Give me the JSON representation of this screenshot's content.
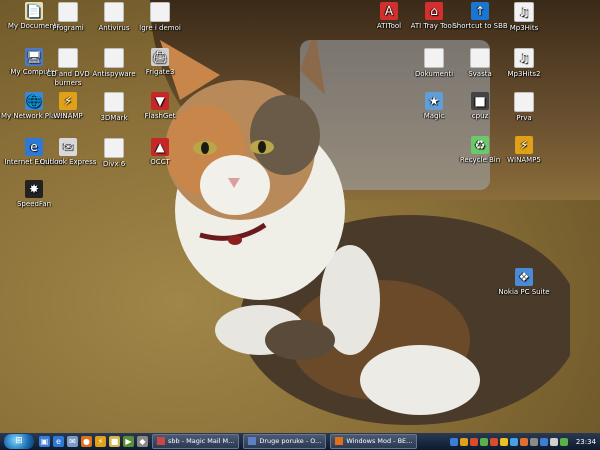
{
  "desktop": {
    "icons": [
      {
        "label": "My Documents",
        "glyph": "📄",
        "style": "g-docs"
      },
      {
        "label": "Programi",
        "glyph": "",
        "style": "g-folder"
      },
      {
        "label": "Antivirus",
        "glyph": "",
        "style": "g-folder"
      },
      {
        "label": "Igre i demoi",
        "glyph": "",
        "style": "g-folder"
      },
      {
        "label": "My Computer",
        "glyph": "🖥",
        "style": "g-pc"
      },
      {
        "label": "CD and DVD burners",
        "glyph": "",
        "style": "g-folder"
      },
      {
        "label": "Antispyware",
        "glyph": "",
        "style": "g-folder"
      },
      {
        "label": "Frigate3",
        "glyph": "🖨",
        "style": "g-printer"
      },
      {
        "label": "My Network Places",
        "glyph": "🌐",
        "style": "g-net"
      },
      {
        "label": "WINAMP",
        "glyph": "⚡",
        "style": "g-winamp"
      },
      {
        "label": "3DMark",
        "glyph": "",
        "style": "g-folder"
      },
      {
        "label": "FlashGet",
        "glyph": "▼",
        "style": "g-red"
      },
      {
        "label": "Internet Explorer",
        "glyph": "e",
        "style": "g-ie"
      },
      {
        "label": "Outlook Express",
        "glyph": "✉",
        "style": "g-mail"
      },
      {
        "label": "Divx 6",
        "glyph": "",
        "style": "g-folder"
      },
      {
        "label": "OCCT",
        "glyph": "▲",
        "style": "g-red"
      },
      {
        "label": "SpeedFan",
        "glyph": "✸",
        "style": "g-speedfan"
      },
      {
        "label": "ATITool",
        "glyph": "A",
        "style": "g-ati"
      },
      {
        "label": "ATI Tray Tools",
        "glyph": "⌂",
        "style": "g-ati"
      },
      {
        "label": "Shortcut to SBB",
        "glyph": "↑",
        "style": "g-shortcut"
      },
      {
        "label": "Mp3Hits",
        "glyph": "♫",
        "style": "g-folder"
      },
      {
        "label": "Dokumenti",
        "glyph": "",
        "style": "g-folder"
      },
      {
        "label": "Svasta",
        "glyph": "",
        "style": "g-folder"
      },
      {
        "label": "Mp3Hits2",
        "glyph": "♫",
        "style": "g-folder"
      },
      {
        "label": "Magic",
        "glyph": "★",
        "style": "g-magic"
      },
      {
        "label": "cpuz",
        "glyph": "■",
        "style": "g-cpuz"
      },
      {
        "label": "Prva",
        "glyph": "",
        "style": "g-folder"
      },
      {
        "label": "Recycle Bin",
        "glyph": "♻",
        "style": "g-bin"
      },
      {
        "label": "WINAMP5",
        "glyph": "⚡",
        "style": "g-winamp"
      },
      {
        "label": "Nokia PC Suite",
        "glyph": "❖",
        "style": "g-nokia"
      }
    ]
  },
  "taskbar": {
    "start_glyph": "⊞",
    "quick_launch": [
      {
        "name": "show-desktop-icon",
        "glyph": "▣",
        "color": "#3b7dd8"
      },
      {
        "name": "internet-explorer-icon",
        "glyph": "e",
        "color": "#2f79d6"
      },
      {
        "name": "outlook-express-icon",
        "glyph": "✉",
        "color": "#7a9cc6"
      },
      {
        "name": "firefox-icon",
        "glyph": "●",
        "color": "#e0701a"
      },
      {
        "name": "winamp-icon",
        "glyph": "⚡",
        "color": "#e0a118"
      },
      {
        "name": "folder-icon",
        "glyph": "■",
        "color": "#d9b64a"
      },
      {
        "name": "media-icon",
        "glyph": "▶",
        "color": "#5a8f3a"
      },
      {
        "name": "app-icon",
        "glyph": "◆",
        "color": "#888888"
      }
    ],
    "tasks": [
      {
        "label": "sbb - Magic Mail M...",
        "icon_color": "#c84848"
      },
      {
        "label": "Druge poruke - O...",
        "icon_color": "#5d7fc4"
      },
      {
        "label": "Windows Mod - BE...",
        "icon_color": "#e0701a"
      }
    ],
    "tray_icons": [
      "#3a7fd6",
      "#e0a118",
      "#d94b2b",
      "#5ab04a",
      "#d94b2b",
      "#f0c020",
      "#48a0e0",
      "#e07030",
      "#8a8a8a",
      "#3a7fd6",
      "#d0d0d0",
      "#5ab04a"
    ],
    "clock": "23:34"
  }
}
